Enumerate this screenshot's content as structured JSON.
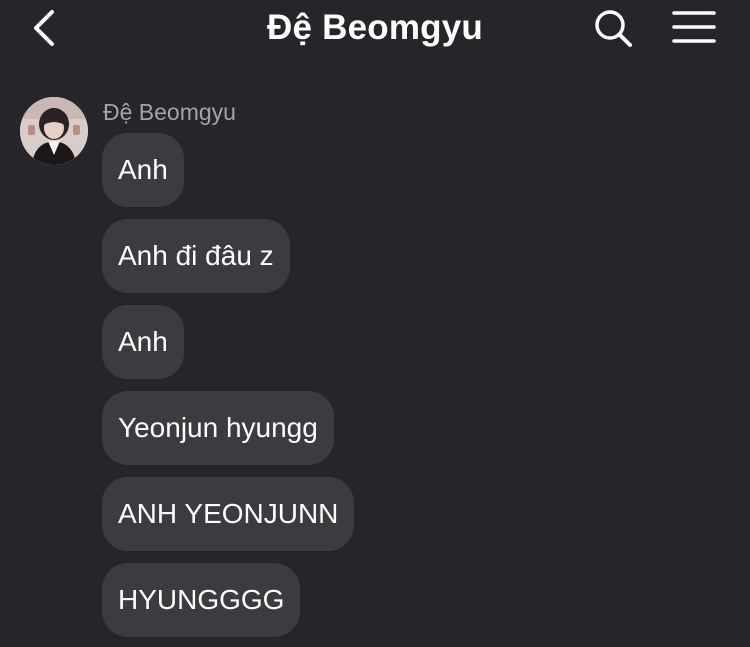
{
  "header": {
    "title": "Đệ Beomgyu",
    "back_icon": "chevron-left-icon",
    "search_icon": "search-icon",
    "menu_icon": "hamburger-menu-icon"
  },
  "conversation": {
    "sender_name": "Đệ Beomgyu",
    "messages": [
      {
        "text": "Anh"
      },
      {
        "text": "Anh đi đâu z"
      },
      {
        "text": "Anh"
      },
      {
        "text": "Yeonjun hyungg"
      },
      {
        "text": "ANH YEONJUNN"
      },
      {
        "text": "HYUNGGGG"
      }
    ]
  },
  "colors": {
    "background": "#26262a",
    "bubble": "#3c3c40",
    "text": "#ffffff",
    "sender_name": "#a3a3a8"
  }
}
